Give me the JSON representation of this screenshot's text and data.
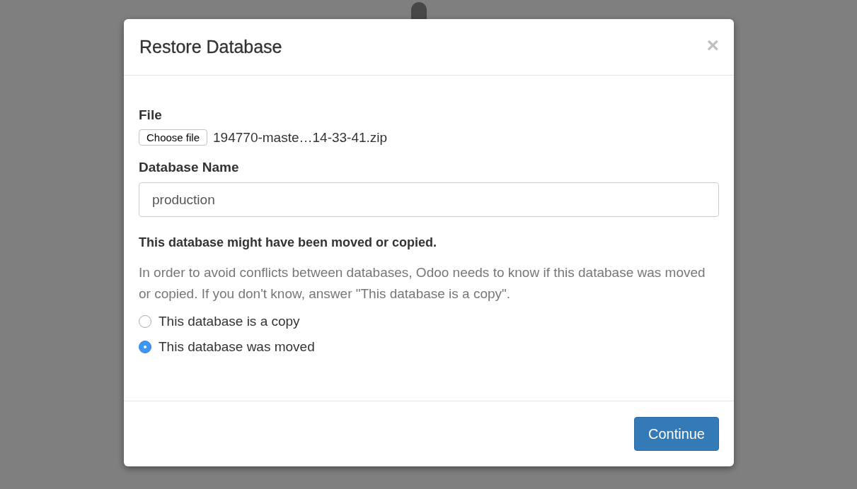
{
  "dialog": {
    "title": "Restore Database",
    "close": "×"
  },
  "file": {
    "label": "File",
    "button": "Choose file",
    "filename": "194770-maste…14-33-41.zip"
  },
  "database_name": {
    "label": "Database Name",
    "value": "production"
  },
  "notice": {
    "heading": "This database might have been moved or copied.",
    "text": "In order to avoid conflicts between databases, Odoo needs to know if this database was moved or copied. If you don't know, answer \"This database is a copy\"."
  },
  "options": [
    {
      "label": "This database is a copy",
      "selected": false
    },
    {
      "label": "This database was moved",
      "selected": true
    }
  ],
  "buttons": [
    {
      "label": "Continue",
      "kind": "primary"
    }
  ]
}
